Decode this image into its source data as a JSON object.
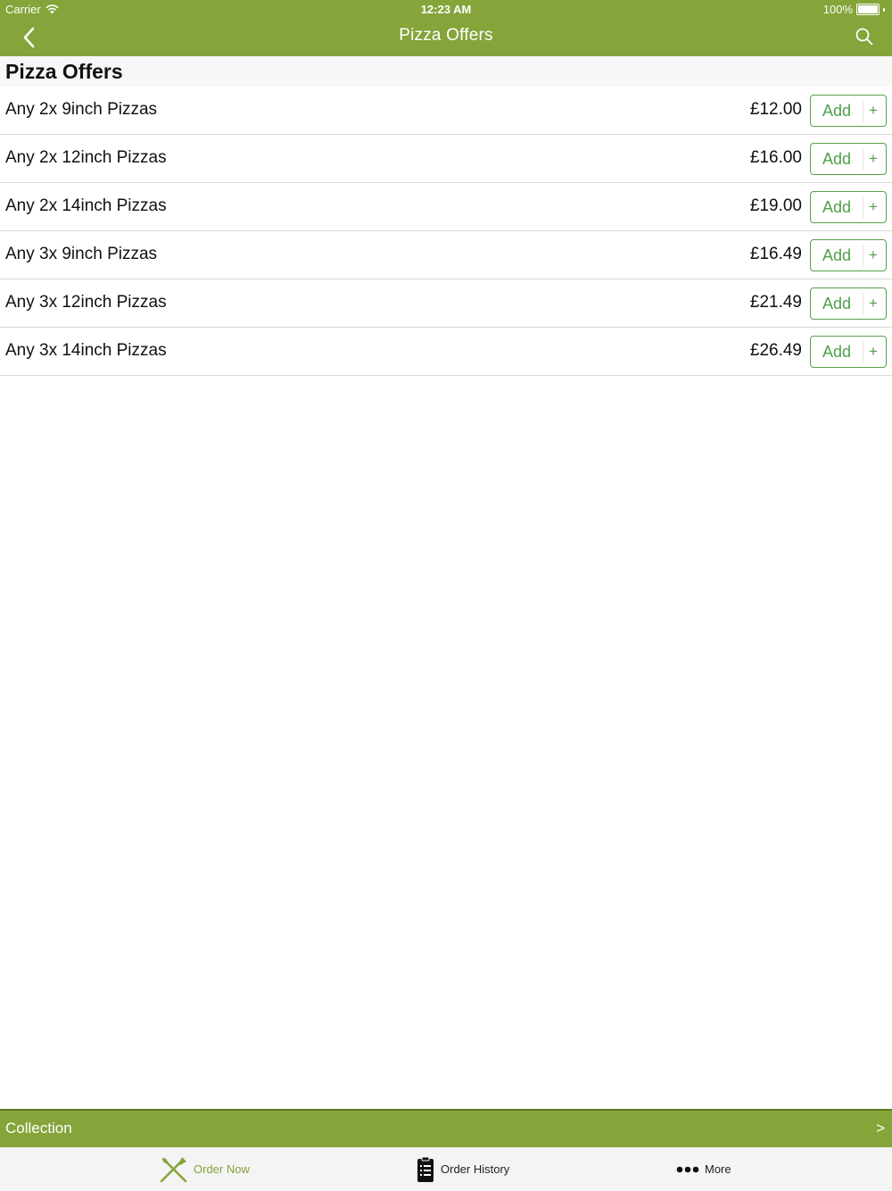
{
  "status_bar": {
    "carrier": "Carrier",
    "time": "12:23 AM",
    "battery": "100%"
  },
  "nav": {
    "title": "Pizza Offers"
  },
  "section": {
    "title": "Pizza Offers"
  },
  "items": [
    {
      "name": "Any 2x 9inch Pizzas",
      "price": "£12.00",
      "add_label": "Add",
      "plus": "+"
    },
    {
      "name": "Any 2x 12inch Pizzas",
      "price": "£16.00",
      "add_label": "Add",
      "plus": "+"
    },
    {
      "name": "Any 2x 14inch Pizzas",
      "price": "£19.00",
      "add_label": "Add",
      "plus": "+"
    },
    {
      "name": "Any 3x 9inch Pizzas",
      "price": "£16.49",
      "add_label": "Add",
      "plus": "+"
    },
    {
      "name": "Any 3x 12inch Pizzas",
      "price": "£21.49",
      "add_label": "Add",
      "plus": "+"
    },
    {
      "name": "Any 3x 14inch Pizzas",
      "price": "£26.49",
      "add_label": "Add",
      "plus": "+"
    }
  ],
  "collection": {
    "label": "Collection",
    "arrow": ">"
  },
  "tabs": [
    {
      "label": "Order Now",
      "icon": "fork-knife-icon",
      "active": true
    },
    {
      "label": "Order History",
      "icon": "clipboard-list-icon",
      "active": false
    },
    {
      "label": "More",
      "icon": "more-dots-icon",
      "active": false
    }
  ],
  "colors": {
    "brand": "#85a43a",
    "button_green": "#4ea04a"
  }
}
